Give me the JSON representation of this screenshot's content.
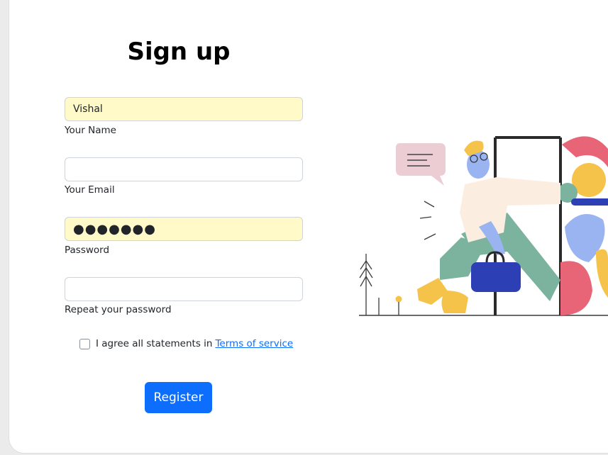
{
  "form": {
    "title": "Sign up",
    "name_value": "Vishal",
    "name_label": "Your Name",
    "email_value": "",
    "email_label": "Your Email",
    "password_value": "●●●●●●●",
    "password_label": "Password",
    "repeat_value": "",
    "repeat_label": "Repeat your password",
    "agree_text": "I agree all statements in",
    "terms_link": "Terms of service",
    "register_label": "Register"
  },
  "colors": {
    "primary": "#0d6efd",
    "autofill": "#fffac8"
  },
  "illustration": "person-walking-through-door"
}
